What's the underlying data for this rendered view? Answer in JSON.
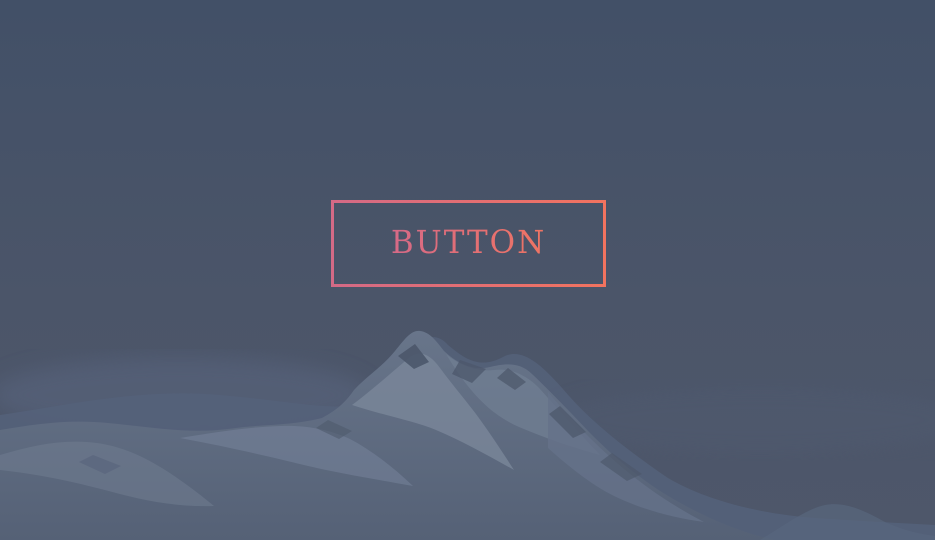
{
  "scene": {
    "background_image": "mountain-peak-photo",
    "overlay_color": "#48536a"
  },
  "cta": {
    "label": "BUTTON",
    "gradient_start": "#d46a86",
    "gradient_end": "#f2735f"
  }
}
